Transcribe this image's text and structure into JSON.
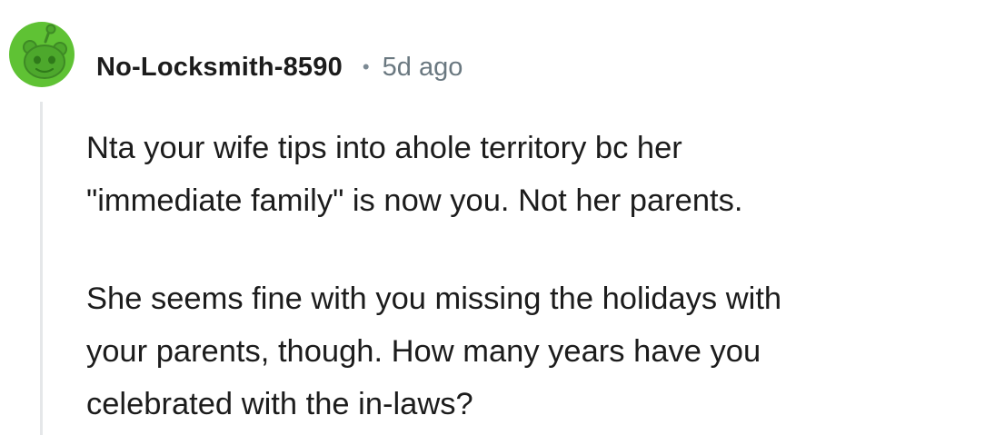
{
  "comment": {
    "author": "No-Locksmith-8590",
    "separator": "•",
    "timestamp": "5d ago",
    "avatar_icon": "reddit-snoo-avatar-icon",
    "avatar_color": "#5fc234",
    "paragraphs": [
      {
        "lines": [
          "Nta your wife tips into ahole territory bc her",
          "\"immediate family\" is now you. Not her parents."
        ]
      },
      {
        "lines": [
          "She seems fine with you missing the holidays with",
          "your parents, though. How many years have you",
          "celebrated with the in-laws?"
        ]
      }
    ]
  }
}
